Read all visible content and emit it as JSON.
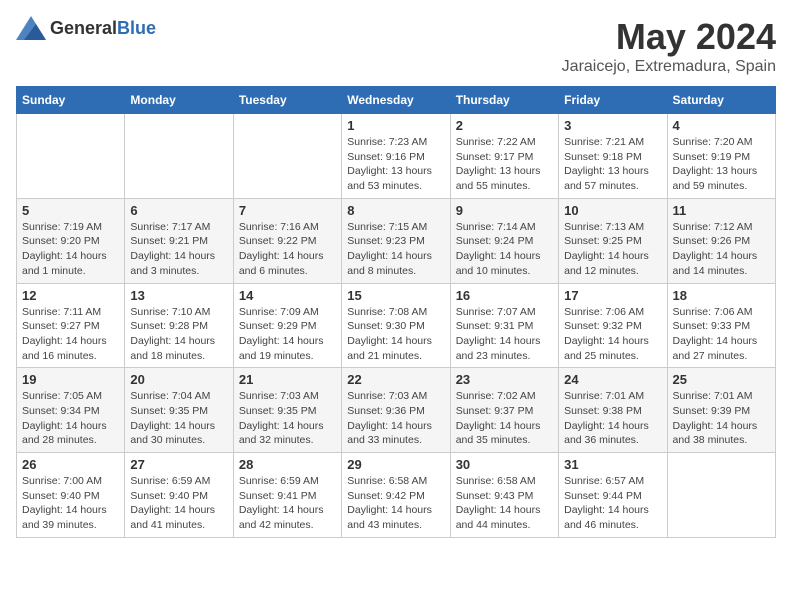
{
  "header": {
    "logo_general": "General",
    "logo_blue": "Blue",
    "month_title": "May 2024",
    "location": "Jaraicejo, Extremadura, Spain"
  },
  "calendar": {
    "days_of_week": [
      "Sunday",
      "Monday",
      "Tuesday",
      "Wednesday",
      "Thursday",
      "Friday",
      "Saturday"
    ],
    "weeks": [
      [
        {
          "day": "",
          "info": ""
        },
        {
          "day": "",
          "info": ""
        },
        {
          "day": "",
          "info": ""
        },
        {
          "day": "1",
          "info": "Sunrise: 7:23 AM\nSunset: 9:16 PM\nDaylight: 13 hours and 53 minutes."
        },
        {
          "day": "2",
          "info": "Sunrise: 7:22 AM\nSunset: 9:17 PM\nDaylight: 13 hours and 55 minutes."
        },
        {
          "day": "3",
          "info": "Sunrise: 7:21 AM\nSunset: 9:18 PM\nDaylight: 13 hours and 57 minutes."
        },
        {
          "day": "4",
          "info": "Sunrise: 7:20 AM\nSunset: 9:19 PM\nDaylight: 13 hours and 59 minutes."
        }
      ],
      [
        {
          "day": "5",
          "info": "Sunrise: 7:19 AM\nSunset: 9:20 PM\nDaylight: 14 hours and 1 minute."
        },
        {
          "day": "6",
          "info": "Sunrise: 7:17 AM\nSunset: 9:21 PM\nDaylight: 14 hours and 3 minutes."
        },
        {
          "day": "7",
          "info": "Sunrise: 7:16 AM\nSunset: 9:22 PM\nDaylight: 14 hours and 6 minutes."
        },
        {
          "day": "8",
          "info": "Sunrise: 7:15 AM\nSunset: 9:23 PM\nDaylight: 14 hours and 8 minutes."
        },
        {
          "day": "9",
          "info": "Sunrise: 7:14 AM\nSunset: 9:24 PM\nDaylight: 14 hours and 10 minutes."
        },
        {
          "day": "10",
          "info": "Sunrise: 7:13 AM\nSunset: 9:25 PM\nDaylight: 14 hours and 12 minutes."
        },
        {
          "day": "11",
          "info": "Sunrise: 7:12 AM\nSunset: 9:26 PM\nDaylight: 14 hours and 14 minutes."
        }
      ],
      [
        {
          "day": "12",
          "info": "Sunrise: 7:11 AM\nSunset: 9:27 PM\nDaylight: 14 hours and 16 minutes."
        },
        {
          "day": "13",
          "info": "Sunrise: 7:10 AM\nSunset: 9:28 PM\nDaylight: 14 hours and 18 minutes."
        },
        {
          "day": "14",
          "info": "Sunrise: 7:09 AM\nSunset: 9:29 PM\nDaylight: 14 hours and 19 minutes."
        },
        {
          "day": "15",
          "info": "Sunrise: 7:08 AM\nSunset: 9:30 PM\nDaylight: 14 hours and 21 minutes."
        },
        {
          "day": "16",
          "info": "Sunrise: 7:07 AM\nSunset: 9:31 PM\nDaylight: 14 hours and 23 minutes."
        },
        {
          "day": "17",
          "info": "Sunrise: 7:06 AM\nSunset: 9:32 PM\nDaylight: 14 hours and 25 minutes."
        },
        {
          "day": "18",
          "info": "Sunrise: 7:06 AM\nSunset: 9:33 PM\nDaylight: 14 hours and 27 minutes."
        }
      ],
      [
        {
          "day": "19",
          "info": "Sunrise: 7:05 AM\nSunset: 9:34 PM\nDaylight: 14 hours and 28 minutes."
        },
        {
          "day": "20",
          "info": "Sunrise: 7:04 AM\nSunset: 9:35 PM\nDaylight: 14 hours and 30 minutes."
        },
        {
          "day": "21",
          "info": "Sunrise: 7:03 AM\nSunset: 9:35 PM\nDaylight: 14 hours and 32 minutes."
        },
        {
          "day": "22",
          "info": "Sunrise: 7:03 AM\nSunset: 9:36 PM\nDaylight: 14 hours and 33 minutes."
        },
        {
          "day": "23",
          "info": "Sunrise: 7:02 AM\nSunset: 9:37 PM\nDaylight: 14 hours and 35 minutes."
        },
        {
          "day": "24",
          "info": "Sunrise: 7:01 AM\nSunset: 9:38 PM\nDaylight: 14 hours and 36 minutes."
        },
        {
          "day": "25",
          "info": "Sunrise: 7:01 AM\nSunset: 9:39 PM\nDaylight: 14 hours and 38 minutes."
        }
      ],
      [
        {
          "day": "26",
          "info": "Sunrise: 7:00 AM\nSunset: 9:40 PM\nDaylight: 14 hours and 39 minutes."
        },
        {
          "day": "27",
          "info": "Sunrise: 6:59 AM\nSunset: 9:40 PM\nDaylight: 14 hours and 41 minutes."
        },
        {
          "day": "28",
          "info": "Sunrise: 6:59 AM\nSunset: 9:41 PM\nDaylight: 14 hours and 42 minutes."
        },
        {
          "day": "29",
          "info": "Sunrise: 6:58 AM\nSunset: 9:42 PM\nDaylight: 14 hours and 43 minutes."
        },
        {
          "day": "30",
          "info": "Sunrise: 6:58 AM\nSunset: 9:43 PM\nDaylight: 14 hours and 44 minutes."
        },
        {
          "day": "31",
          "info": "Sunrise: 6:57 AM\nSunset: 9:44 PM\nDaylight: 14 hours and 46 minutes."
        },
        {
          "day": "",
          "info": ""
        }
      ]
    ]
  }
}
